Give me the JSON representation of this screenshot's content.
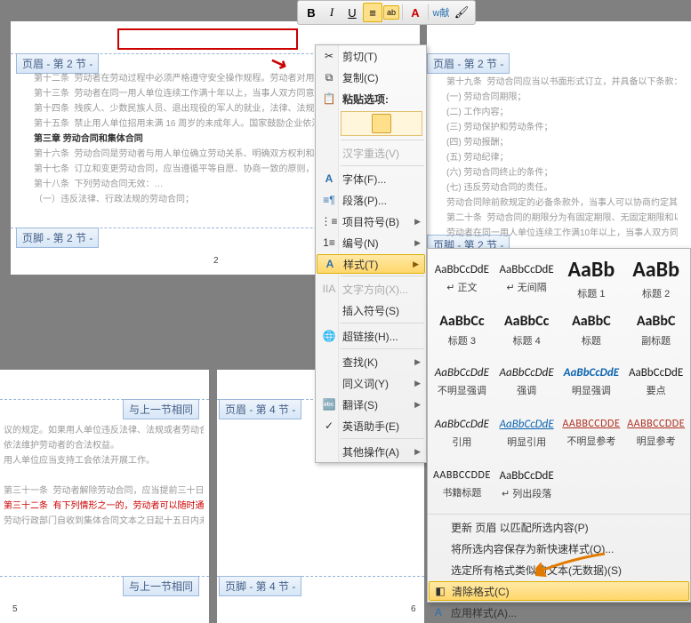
{
  "toolbar": {
    "bold": "B",
    "italic": "I",
    "underline": "U"
  },
  "labels": {
    "header_s2": "页眉 - 第 2 节 -",
    "footer_s2": "页脚 - 第 2 节 -",
    "header_s4": "页眉 - 第 4 节 -",
    "footer_s4": "页脚 - 第 4 节 -",
    "same_prev": "与上一节相同"
  },
  "doc": {
    "ch3": "第三章 劳动合同和集体合同",
    "pg_num_left": "2",
    "pg_num_bl": "5",
    "pg_num_br": "6"
  },
  "ctx": {
    "cut": "剪切(T)",
    "copy": "复制(C)",
    "paste_opts": "粘贴选项:",
    "hanzi": "汉字重选(V)",
    "font": "字体(F)...",
    "para": "段落(P)...",
    "bullets": "项目符号(B)",
    "numbering": "编号(N)",
    "styles": "样式(T)",
    "text_dir": "文字方向(X)...",
    "symbol": "插入符号(S)",
    "link": "超链接(H)...",
    "find": "查找(K)",
    "synonym": "同义词(Y)",
    "translate": "翻译(S)",
    "eng": "英语助手(E)",
    "other": "其他操作(A)"
  },
  "gallery": [
    {
      "sample": "AaBbCcDdE",
      "name": "↵ 正文",
      "cls": "sm"
    },
    {
      "sample": "AaBbCcDdE",
      "name": "↵ 无间隔",
      "cls": "sm"
    },
    {
      "sample": "AaBb",
      "name": "标题 1",
      "cls": "lg"
    },
    {
      "sample": "AaBb",
      "name": "标题 2",
      "cls": "lg"
    },
    {
      "sample": "AaBbCc",
      "name": "标题 3",
      "cls": "md"
    },
    {
      "sample": "AaBbCc",
      "name": "标题 4",
      "cls": "md"
    },
    {
      "sample": "AaBbC",
      "name": "标题",
      "cls": "md"
    },
    {
      "sample": "AaBbC",
      "name": "副标题",
      "cls": "md"
    },
    {
      "sample": "AaBbCcDdE",
      "name": "不明显强调",
      "cls": "em"
    },
    {
      "sample": "AaBbCcDdE",
      "name": "强调",
      "cls": "em"
    },
    {
      "sample": "AaBbCcDdE",
      "name": "明显强调",
      "cls": "emb"
    },
    {
      "sample": "AaBbCcDdE",
      "name": "要点",
      "cls": "sm"
    },
    {
      "sample": "AaBbCcDdE",
      "name": "引用",
      "cls": "em"
    },
    {
      "sample": "AaBbCcDdE",
      "name": "明显引用",
      "cls": "und blue"
    },
    {
      "sample": "AABBCCDDE",
      "name": "不明显参考",
      "cls": "cap link"
    },
    {
      "sample": "AABBCCDDE",
      "name": "明显参考",
      "cls": "cap link"
    },
    {
      "sample": "AABBCCDDE",
      "name": "书籍标题",
      "cls": "cap"
    },
    {
      "sample": "AaBbCcDdE",
      "name": "↵ 列出段落",
      "cls": "sm"
    }
  ],
  "fly": {
    "update": "更新 页眉 以匹配所选内容(P)",
    "save_sel": "将所选内容保存为新快速样式(Q)...",
    "select_same": "选定所有格式类似的文本(无数据)(S)",
    "clear_fmt": "清除格式(C)",
    "apply": "应用样式(A)..."
  }
}
